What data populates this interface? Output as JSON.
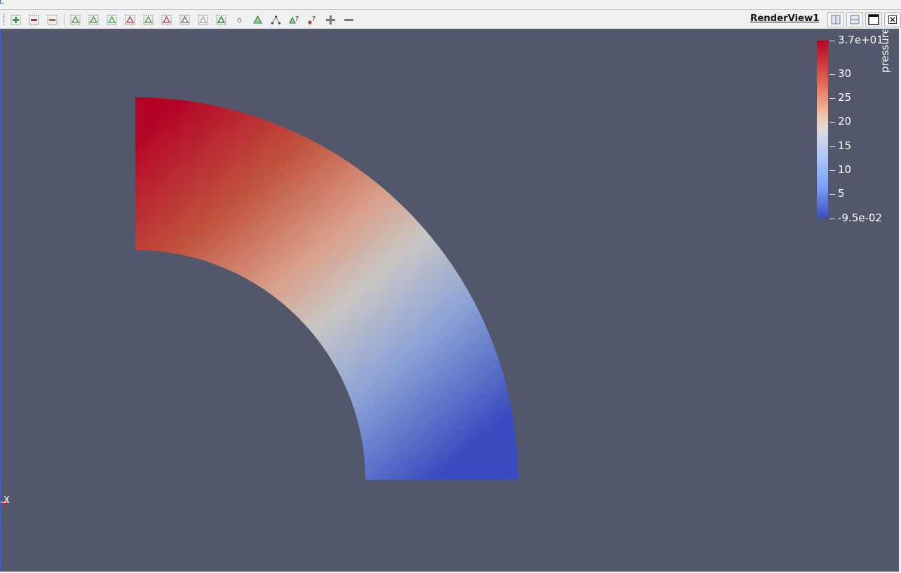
{
  "colors": {
    "viewport_background": "#52576b",
    "active_view_border": "#3b5fd8",
    "colormap_high": "#b40426",
    "colormap_mid": "#dddcdc",
    "colormap_low": "#3b4cc0"
  },
  "toolbar": {
    "icons": [
      "add-selection-icon",
      "subtract-selection-icon",
      "toggle-selection-icon",
      "select-cells-on-icon",
      "select-points-on-icon",
      "select-cells-frustum-icon",
      "select-points-frustum-icon",
      "select-cells-polygon-icon",
      "select-points-polygon-icon",
      "select-block-icon",
      "interactive-select-icon",
      "hover-points-icon",
      "hover-cells-icon",
      "grow-selection-point-icon",
      "hover-query-icon",
      "probe-query-icon",
      "grow-selection-icon",
      "shrink-selection-icon",
      "clear-selection-icon"
    ]
  },
  "view": {
    "title": "RenderView1",
    "buttons": [
      "split-horizontal-icon",
      "split-vertical-icon",
      "maximize-icon",
      "close-icon"
    ]
  },
  "colorbar": {
    "title": "pressure",
    "range": [
      -0.095,
      37
    ],
    "ticks": [
      {
        "value": 37,
        "label": "3.7e+01"
      },
      {
        "value": 30,
        "label": "30"
      },
      {
        "value": 25,
        "label": "25"
      },
      {
        "value": 20,
        "label": "20"
      },
      {
        "value": 15,
        "label": "15"
      },
      {
        "value": 10,
        "label": "10"
      },
      {
        "value": 5,
        "label": "5"
      },
      {
        "value": -0.095,
        "label": "-9.5e-02"
      }
    ]
  },
  "orientation_axes": {
    "x_label": "X"
  }
}
